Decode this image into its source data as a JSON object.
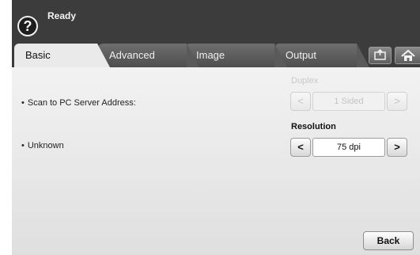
{
  "status": {
    "text": "Ready",
    "help_glyph": "?"
  },
  "tabs": [
    {
      "label": "Basic",
      "active": true
    },
    {
      "label": "Advanced",
      "active": false
    },
    {
      "label": "Image",
      "active": false
    },
    {
      "label": "Output",
      "active": false
    }
  ],
  "toolbar_icons": [
    "job-status-icon",
    "home-icon"
  ],
  "settings": {
    "scan_server_label": "Scan to PC Server Address:",
    "unknown_label": "Unknown"
  },
  "duplex": {
    "title": "Duplex",
    "value": "1 Sided",
    "enabled": false,
    "prev": "<",
    "next": ">"
  },
  "resolution": {
    "title": "Resolution",
    "value": "75 dpi",
    "enabled": true,
    "prev": "<",
    "next": ">"
  },
  "back_label": "Back"
}
